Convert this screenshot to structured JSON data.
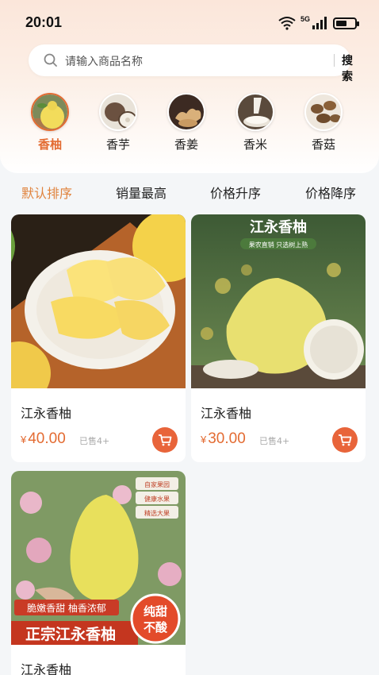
{
  "status_bar": {
    "time": "20:01",
    "network": "5G",
    "battery_level": 0.6
  },
  "search": {
    "placeholder": "请输入商品名称",
    "button_label": "搜索"
  },
  "categories": [
    {
      "label": "香柚",
      "active": true
    },
    {
      "label": "香芋",
      "active": false
    },
    {
      "label": "香姜",
      "active": false
    },
    {
      "label": "香米",
      "active": false
    },
    {
      "label": "香菇",
      "active": false
    }
  ],
  "sort_tabs": [
    {
      "label": "默认排序",
      "active": true
    },
    {
      "label": "销量最高",
      "active": false
    },
    {
      "label": "价格升序",
      "active": false
    },
    {
      "label": "价格降序",
      "active": false
    }
  ],
  "products": [
    {
      "title": "江永香柚",
      "currency": "¥",
      "price": "40.00",
      "sold": "已售4+"
    },
    {
      "title": "江永香柚",
      "currency": "¥",
      "price": "30.00",
      "sold": "已售4+",
      "image_text": {
        "headline": "江永香柚",
        "tagline": "果农直销 只选树上熟"
      }
    },
    {
      "title": "江永香柚",
      "image_text": {
        "badge_lines": [
          "自家果园",
          "健康水果",
          "精选大果"
        ],
        "ribbon": "脆嫩香甜 柚香浓郁",
        "banner": "正宗江永香柚",
        "seal_line1": "纯甜",
        "seal_line2": "不酸"
      }
    }
  ],
  "colors": {
    "accent": "#e36b32",
    "sort_active": "#e0833d",
    "cart": "#e8643a"
  }
}
